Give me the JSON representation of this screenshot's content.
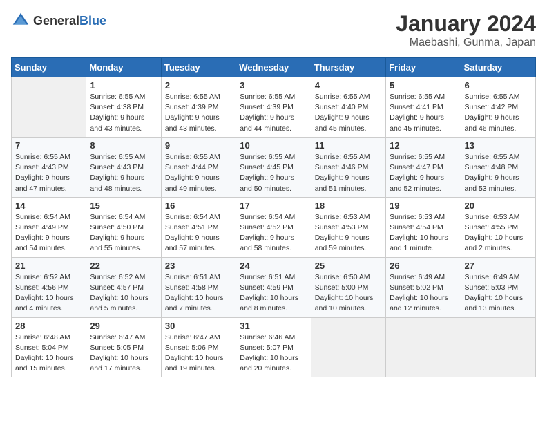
{
  "header": {
    "logo_general": "General",
    "logo_blue": "Blue",
    "month_year": "January 2024",
    "location": "Maebashi, Gunma, Japan"
  },
  "weekdays": [
    "Sunday",
    "Monday",
    "Tuesday",
    "Wednesday",
    "Thursday",
    "Friday",
    "Saturday"
  ],
  "weeks": [
    [
      {
        "day": "",
        "sunrise": "",
        "sunset": "",
        "daylight": ""
      },
      {
        "day": "1",
        "sunrise": "Sunrise: 6:55 AM",
        "sunset": "Sunset: 4:38 PM",
        "daylight": "Daylight: 9 hours and 43 minutes."
      },
      {
        "day": "2",
        "sunrise": "Sunrise: 6:55 AM",
        "sunset": "Sunset: 4:39 PM",
        "daylight": "Daylight: 9 hours and 43 minutes."
      },
      {
        "day": "3",
        "sunrise": "Sunrise: 6:55 AM",
        "sunset": "Sunset: 4:39 PM",
        "daylight": "Daylight: 9 hours and 44 minutes."
      },
      {
        "day": "4",
        "sunrise": "Sunrise: 6:55 AM",
        "sunset": "Sunset: 4:40 PM",
        "daylight": "Daylight: 9 hours and 45 minutes."
      },
      {
        "day": "5",
        "sunrise": "Sunrise: 6:55 AM",
        "sunset": "Sunset: 4:41 PM",
        "daylight": "Daylight: 9 hours and 45 minutes."
      },
      {
        "day": "6",
        "sunrise": "Sunrise: 6:55 AM",
        "sunset": "Sunset: 4:42 PM",
        "daylight": "Daylight: 9 hours and 46 minutes."
      }
    ],
    [
      {
        "day": "7",
        "sunrise": "Sunrise: 6:55 AM",
        "sunset": "Sunset: 4:43 PM",
        "daylight": "Daylight: 9 hours and 47 minutes."
      },
      {
        "day": "8",
        "sunrise": "Sunrise: 6:55 AM",
        "sunset": "Sunset: 4:43 PM",
        "daylight": "Daylight: 9 hours and 48 minutes."
      },
      {
        "day": "9",
        "sunrise": "Sunrise: 6:55 AM",
        "sunset": "Sunset: 4:44 PM",
        "daylight": "Daylight: 9 hours and 49 minutes."
      },
      {
        "day": "10",
        "sunrise": "Sunrise: 6:55 AM",
        "sunset": "Sunset: 4:45 PM",
        "daylight": "Daylight: 9 hours and 50 minutes."
      },
      {
        "day": "11",
        "sunrise": "Sunrise: 6:55 AM",
        "sunset": "Sunset: 4:46 PM",
        "daylight": "Daylight: 9 hours and 51 minutes."
      },
      {
        "day": "12",
        "sunrise": "Sunrise: 6:55 AM",
        "sunset": "Sunset: 4:47 PM",
        "daylight": "Daylight: 9 hours and 52 minutes."
      },
      {
        "day": "13",
        "sunrise": "Sunrise: 6:55 AM",
        "sunset": "Sunset: 4:48 PM",
        "daylight": "Daylight: 9 hours and 53 minutes."
      }
    ],
    [
      {
        "day": "14",
        "sunrise": "Sunrise: 6:54 AM",
        "sunset": "Sunset: 4:49 PM",
        "daylight": "Daylight: 9 hours and 54 minutes."
      },
      {
        "day": "15",
        "sunrise": "Sunrise: 6:54 AM",
        "sunset": "Sunset: 4:50 PM",
        "daylight": "Daylight: 9 hours and 55 minutes."
      },
      {
        "day": "16",
        "sunrise": "Sunrise: 6:54 AM",
        "sunset": "Sunset: 4:51 PM",
        "daylight": "Daylight: 9 hours and 57 minutes."
      },
      {
        "day": "17",
        "sunrise": "Sunrise: 6:54 AM",
        "sunset": "Sunset: 4:52 PM",
        "daylight": "Daylight: 9 hours and 58 minutes."
      },
      {
        "day": "18",
        "sunrise": "Sunrise: 6:53 AM",
        "sunset": "Sunset: 4:53 PM",
        "daylight": "Daylight: 9 hours and 59 minutes."
      },
      {
        "day": "19",
        "sunrise": "Sunrise: 6:53 AM",
        "sunset": "Sunset: 4:54 PM",
        "daylight": "Daylight: 10 hours and 1 minute."
      },
      {
        "day": "20",
        "sunrise": "Sunrise: 6:53 AM",
        "sunset": "Sunset: 4:55 PM",
        "daylight": "Daylight: 10 hours and 2 minutes."
      }
    ],
    [
      {
        "day": "21",
        "sunrise": "Sunrise: 6:52 AM",
        "sunset": "Sunset: 4:56 PM",
        "daylight": "Daylight: 10 hours and 4 minutes."
      },
      {
        "day": "22",
        "sunrise": "Sunrise: 6:52 AM",
        "sunset": "Sunset: 4:57 PM",
        "daylight": "Daylight: 10 hours and 5 minutes."
      },
      {
        "day": "23",
        "sunrise": "Sunrise: 6:51 AM",
        "sunset": "Sunset: 4:58 PM",
        "daylight": "Daylight: 10 hours and 7 minutes."
      },
      {
        "day": "24",
        "sunrise": "Sunrise: 6:51 AM",
        "sunset": "Sunset: 4:59 PM",
        "daylight": "Daylight: 10 hours and 8 minutes."
      },
      {
        "day": "25",
        "sunrise": "Sunrise: 6:50 AM",
        "sunset": "Sunset: 5:00 PM",
        "daylight": "Daylight: 10 hours and 10 minutes."
      },
      {
        "day": "26",
        "sunrise": "Sunrise: 6:49 AM",
        "sunset": "Sunset: 5:02 PM",
        "daylight": "Daylight: 10 hours and 12 minutes."
      },
      {
        "day": "27",
        "sunrise": "Sunrise: 6:49 AM",
        "sunset": "Sunset: 5:03 PM",
        "daylight": "Daylight: 10 hours and 13 minutes."
      }
    ],
    [
      {
        "day": "28",
        "sunrise": "Sunrise: 6:48 AM",
        "sunset": "Sunset: 5:04 PM",
        "daylight": "Daylight: 10 hours and 15 minutes."
      },
      {
        "day": "29",
        "sunrise": "Sunrise: 6:47 AM",
        "sunset": "Sunset: 5:05 PM",
        "daylight": "Daylight: 10 hours and 17 minutes."
      },
      {
        "day": "30",
        "sunrise": "Sunrise: 6:47 AM",
        "sunset": "Sunset: 5:06 PM",
        "daylight": "Daylight: 10 hours and 19 minutes."
      },
      {
        "day": "31",
        "sunrise": "Sunrise: 6:46 AM",
        "sunset": "Sunset: 5:07 PM",
        "daylight": "Daylight: 10 hours and 20 minutes."
      },
      {
        "day": "",
        "sunrise": "",
        "sunset": "",
        "daylight": ""
      },
      {
        "day": "",
        "sunrise": "",
        "sunset": "",
        "daylight": ""
      },
      {
        "day": "",
        "sunrise": "",
        "sunset": "",
        "daylight": ""
      }
    ]
  ]
}
